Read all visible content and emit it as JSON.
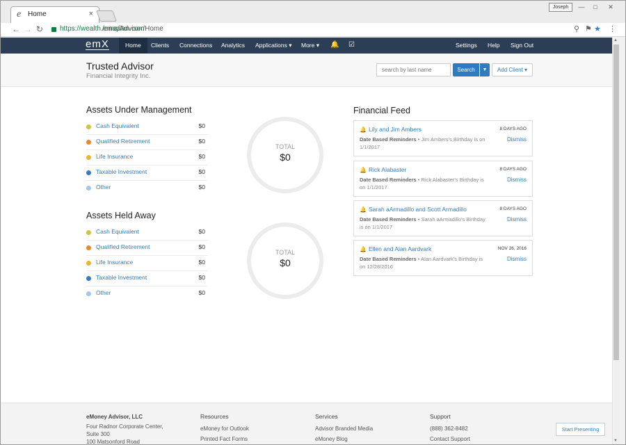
{
  "browser": {
    "tab_title": "Home",
    "tab_icon": "e",
    "tab_close": "×",
    "profile_label": "Joseph",
    "url_secure": "https://wealth.emaplan.com",
    "url_path": "/ema/Advisor/Home"
  },
  "nav": {
    "logo": "emX",
    "items": [
      {
        "label": "Home"
      },
      {
        "label": "Clients"
      },
      {
        "label": "Connections"
      },
      {
        "label": "Analytics"
      },
      {
        "label": "Applications ▾"
      },
      {
        "label": "More ▾"
      }
    ],
    "right": [
      {
        "label": "Settings"
      },
      {
        "label": "Help"
      },
      {
        "label": "Sign Out"
      }
    ]
  },
  "header": {
    "title": "Trusted Advisor",
    "subtitle": "Financial Integrity Inc.",
    "search_placeholder": "search by last name",
    "search_button": "Search",
    "add_client": "Add Client ▾"
  },
  "colors": {
    "cash": "#c9c64a",
    "retirement": "#e8892b",
    "life": "#e8b82b",
    "taxable": "#3a78c9",
    "other": "#a8c6e6"
  },
  "aum": {
    "title": "Assets Under Management",
    "rows": [
      {
        "label": "Cash Equivalent",
        "value": "$0"
      },
      {
        "label": "Qualified Retirement",
        "value": "$0"
      },
      {
        "label": "Life Insurance",
        "value": "$0"
      },
      {
        "label": "Taxable Investment",
        "value": "$0"
      },
      {
        "label": "Other",
        "value": "$0"
      }
    ],
    "total_label": "TOTAL",
    "total_value": "$0"
  },
  "away": {
    "title": "Assets Held Away",
    "rows": [
      {
        "label": "Cash Equivalent",
        "value": "$0"
      },
      {
        "label": "Qualified Retirement",
        "value": "$0"
      },
      {
        "label": "Life Insurance",
        "value": "$0"
      },
      {
        "label": "Taxable Investment",
        "value": "$0"
      },
      {
        "label": "Other",
        "value": "$0"
      }
    ],
    "total_label": "TOTAL",
    "total_value": "$0"
  },
  "feed": {
    "title": "Financial Feed",
    "items": [
      {
        "name": "Lily and Jim Ambers",
        "date": "8 DAYS AGO",
        "type": "Date Based Reminders",
        "text": " • Jim Ambers's Birthday is on 1/1/2017",
        "action": "Dismiss"
      },
      {
        "name": "Rick Alabaster",
        "date": "8 DAYS AGO",
        "type": "Date Based Reminders",
        "text": " • Rick Alabaster's Birthday is on 1/1/2017",
        "action": "Dismiss"
      },
      {
        "name": "Sarah aArmadillo and Scott Armadillo",
        "date": "8 DAYS AGO",
        "type": "Date Based Reminders",
        "text": " • Sarah aArmadillo's Birthday is on 1/1/2017",
        "action": "Dismiss"
      },
      {
        "name": "Ellen and Alan Aardvark",
        "date": "NOV 26, 2016",
        "type": "Date Based Reminders",
        "text": " • Alan Aardvark's Birthday is on 12/28/2016",
        "action": "Dismiss"
      }
    ]
  },
  "footer": {
    "company": {
      "name": "eMoney Advisor, LLC",
      "line1": "Four Radnor Corporate Center,",
      "line2": "Suite 300",
      "line3": "100 Matsonford Road"
    },
    "resources": {
      "heading": "Resources",
      "links": [
        "eMoney for Outlook",
        "Printed Fact Forms"
      ]
    },
    "services": {
      "heading": "Services",
      "links": [
        "Advisor Branded Media",
        "eMoney Blog"
      ]
    },
    "support": {
      "heading": "Support",
      "links": [
        "(888) 362-8482",
        "Contact Support"
      ]
    },
    "start_button": "Start Presenting"
  }
}
